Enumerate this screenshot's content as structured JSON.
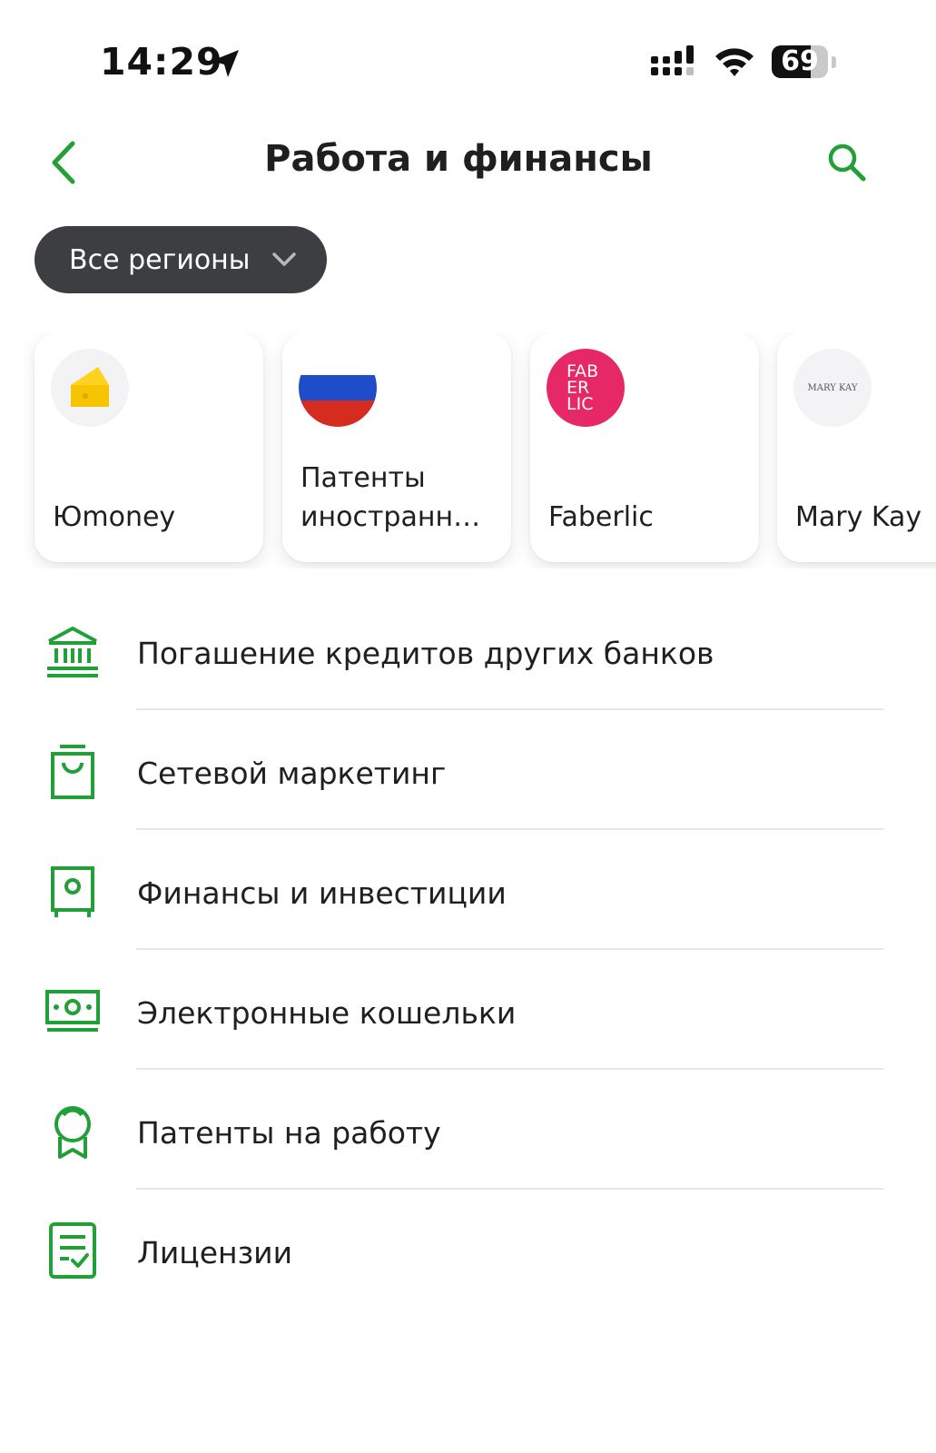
{
  "status_bar": {
    "time": "14:29",
    "battery": "69",
    "battery_level_percent": 69,
    "icons": [
      "location-arrow-icon",
      "cellular-signal-icon",
      "wifi-icon",
      "battery-icon"
    ]
  },
  "header": {
    "title": "Работа и финансы",
    "back_icon": "chevron-left-icon",
    "search_icon": "search-icon"
  },
  "colors": {
    "accent": "#21a038",
    "chip_background": "#3d3e41",
    "faberlic": "#e72866",
    "yoomoney": "#ffd21f"
  },
  "region_filter": {
    "label": "Все регионы",
    "icon": "chevron-down-icon"
  },
  "cards": [
    {
      "label": "Юmoney",
      "logo": "yoomoney-logo"
    },
    {
      "label_line1": "Патенты",
      "label_line2": "иностранны...",
      "logo": "russia-flag-logo"
    },
    {
      "label": "Faberlic",
      "logo": "faberlic-logo",
      "logo_text": [
        "FAB",
        "ER",
        "LIC"
      ]
    },
    {
      "label": "Mary Kay",
      "logo": "mary-kay-logo",
      "logo_text": "MARY KAY"
    }
  ],
  "categories": [
    {
      "label": "Погашение кредитов других банков",
      "icon": "bank-icon"
    },
    {
      "label": "Сетевой маркетинг",
      "icon": "shopping-bag-icon"
    },
    {
      "label": "Финансы и инвестиции",
      "icon": "safe-icon"
    },
    {
      "label": "Электронные кошельки",
      "icon": "banknote-icon"
    },
    {
      "label": "Патенты на работу",
      "icon": "award-badge-icon"
    },
    {
      "label": "Лицензии",
      "icon": "document-check-icon"
    }
  ]
}
